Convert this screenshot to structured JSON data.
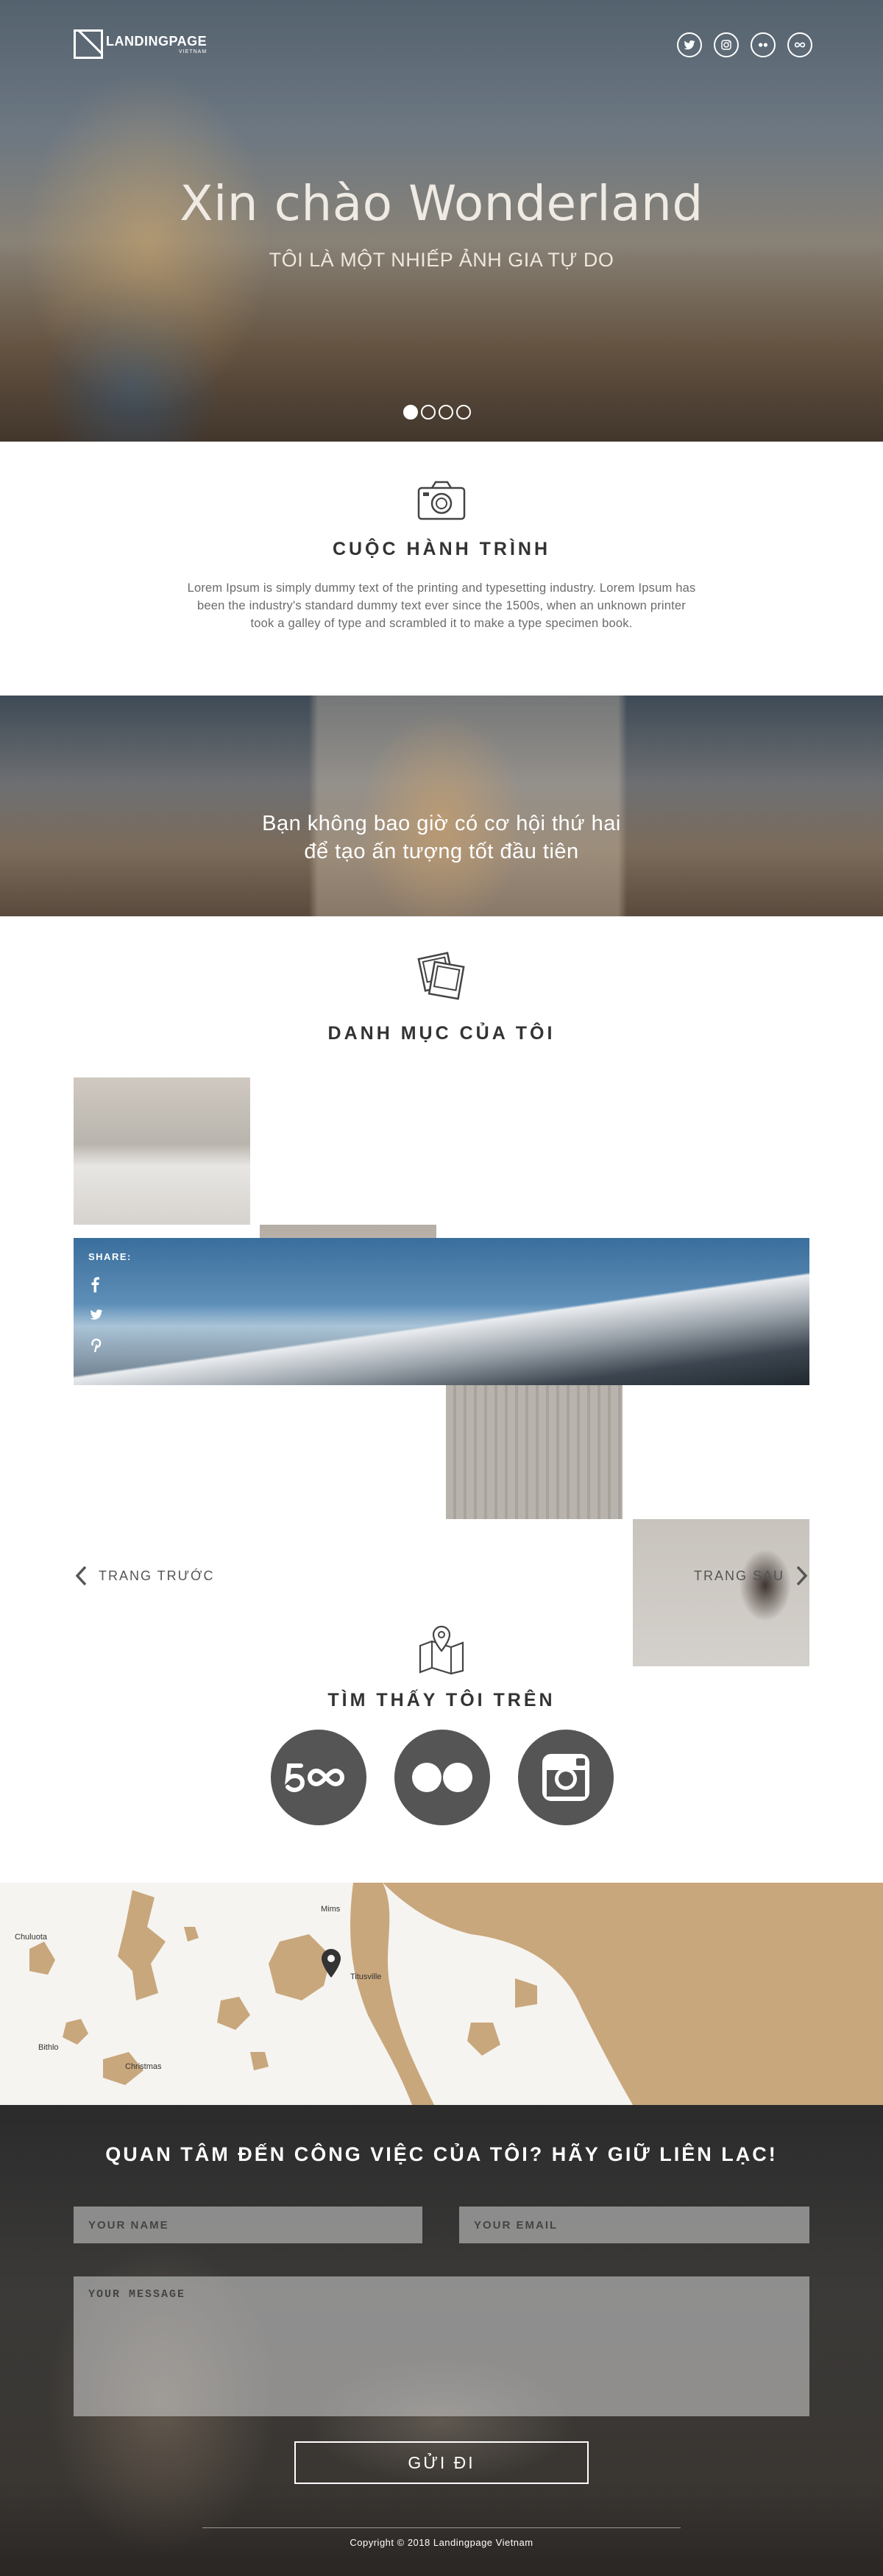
{
  "brand": {
    "logo_text": "LANDINGPAGE",
    "logo_sub": "VIETNAM"
  },
  "header": {
    "social_icons": [
      "twitter-icon",
      "instagram-icon",
      "flickr-icon",
      "500px-icon"
    ]
  },
  "hero": {
    "title": "Xin chào Wonderland",
    "subtitle": "TÔI LÀ MỘT NHIẾP ẢNH GIA TỰ DO",
    "slides_total": 4,
    "slide_active": 1
  },
  "about": {
    "icon": "camera-icon",
    "title": "CUỘC HÀNH TRÌNH",
    "text": "Lorem Ipsum is simply dummy text of the printing and typesetting industry. Lorem Ipsum has been the industry's standard dummy text ever since the 1500s, when an unknown printer took a galley of type and scrambled it to make a type specimen book."
  },
  "quote": {
    "line1": "Bạn không bao giờ có cơ hội thứ hai",
    "line2": "để tạo ấn tượng tốt đầu tiên"
  },
  "portfolio": {
    "icon": "photos-icon",
    "title": "DANH MỤC CỦA TÔI",
    "share_label": "SHARE:",
    "share_icons": [
      "facebook-icon",
      "twitter-icon",
      "pinterest-icon"
    ],
    "prev_label": "TRANG TRƯỚC",
    "next_label": "TRANG SAU"
  },
  "find_me": {
    "icon": "map-pin-icon",
    "title": "TÌM THẤY TÔI TRÊN",
    "networks": [
      "500px-icon",
      "flickr-icon",
      "instagram-icon"
    ]
  },
  "map": {
    "labels": {
      "mims": "Mims",
      "titusville": "Titusville",
      "chuluota": "Chuluota",
      "bithlo": "Bithlo",
      "christmas": "Christmas"
    },
    "land_color": "#c9a77c"
  },
  "contact": {
    "title": "QUAN TÂM ĐẾN CÔNG VIỆC CỦA TÔI? HÃY GIỮ LIÊN LẠC!",
    "name_placeholder": "YOUR NAME",
    "email_placeholder": "YOUR EMAIL",
    "message_placeholder": "YOUR MESSAGE",
    "send_label": "GỬI ĐI"
  },
  "footer": {
    "copyright": "Copyright © 2018 Landingpage Vietnam"
  }
}
